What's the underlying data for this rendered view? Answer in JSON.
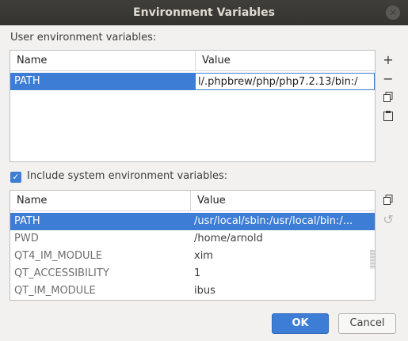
{
  "window": {
    "title": "Environment Variables",
    "close_icon": "close-icon"
  },
  "user_section": {
    "label": "User environment variables:",
    "columns": [
      "Name",
      "Value"
    ],
    "rows": [
      {
        "name": "PATH",
        "value": "l/.phpbrew/php/php7.2.13/bin:/"
      }
    ],
    "tools": [
      "plus-icon",
      "minus-icon",
      "copy-icon",
      "paste-icon"
    ]
  },
  "system_section": {
    "checkbox_label": "Include system environment variables:",
    "checked": true,
    "columns": [
      "Name",
      "Value"
    ],
    "rows": [
      {
        "name": "PATH",
        "value": "/usr/local/sbin:/usr/local/bin:/..."
      },
      {
        "name": "PWD",
        "value": "/home/arnold"
      },
      {
        "name": "QT4_IM_MODULE",
        "value": "xim"
      },
      {
        "name": "QT_ACCESSIBILITY",
        "value": "1"
      },
      {
        "name": "QT_IM_MODULE",
        "value": "ibus"
      }
    ],
    "tools": [
      "copy-icon",
      "undo-icon"
    ]
  },
  "buttons": {
    "ok": "OK",
    "cancel": "Cancel"
  },
  "colors": {
    "selection": "#3d7dd6",
    "titlebar": "#3f3e3b"
  }
}
